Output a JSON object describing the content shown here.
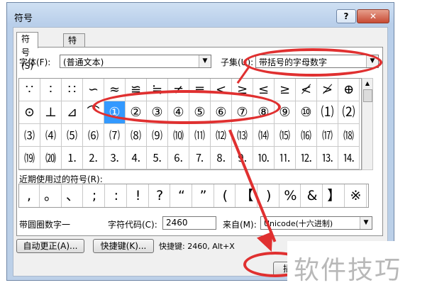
{
  "window": {
    "title": "符号",
    "help": "?",
    "close": "✕"
  },
  "tabs": [
    "符号(S)",
    "特殊字符(P)"
  ],
  "font": {
    "label": "字体(F):",
    "value": "(普通文本)"
  },
  "subset": {
    "label": "子集(U):",
    "value": "带括号的字母数字"
  },
  "grid_rows": [
    [
      "∵",
      "∶",
      "∷",
      "∽",
      "≈",
      "≌",
      "≒",
      "≠",
      "≡",
      "<",
      "≥",
      "≤",
      "≥",
      "≮",
      "≯",
      "⊕"
    ],
    [
      "⊙",
      "⊥",
      "⊿",
      "⌒",
      "①",
      "②",
      "③",
      "④",
      "⑤",
      "⑥",
      "⑦",
      "⑧",
      "⑨",
      "⑩",
      "⑴",
      "⑵"
    ],
    [
      "⑶",
      "⑷",
      "⑸",
      "⑹",
      "⑺",
      "⑻",
      "⑼",
      "⑽",
      "⑾",
      "⑿",
      "⒀",
      "⒁",
      "⒂",
      "⒃",
      "⒄",
      "⒅"
    ],
    [
      "⒆",
      "⒇",
      "⒈",
      "⒉",
      "⒊",
      "⒋",
      "⒌",
      "⒍",
      "⒎",
      "⒏",
      "⒐",
      "⒑",
      "⒒",
      "⒓",
      "⒔",
      "⒕"
    ]
  ],
  "selected": {
    "row": 1,
    "col": 4
  },
  "recent": {
    "label": "近期使用过的符号(R):",
    "symbols": [
      ",",
      "。",
      "、",
      ";",
      ":",
      "!",
      "?",
      "“",
      "”",
      "(",
      "【",
      ")",
      "%",
      "&",
      "】",
      "※"
    ]
  },
  "char_name": "带圆圈数字一",
  "char_code": {
    "label": "字符代码(C):",
    "value": "2460"
  },
  "from": {
    "label": "来自(M):",
    "value": "Unicode(十六进制)"
  },
  "buttons": {
    "autocorrect": "自动更正(A)...",
    "shortcut_key": "快捷键(K)...",
    "shortcut_text": "快捷键: 2460, Alt+X",
    "insert": "插"
  },
  "watermark": "软件技巧",
  "colors": {
    "highlight": "#e03030",
    "selection": "#3399ff"
  }
}
